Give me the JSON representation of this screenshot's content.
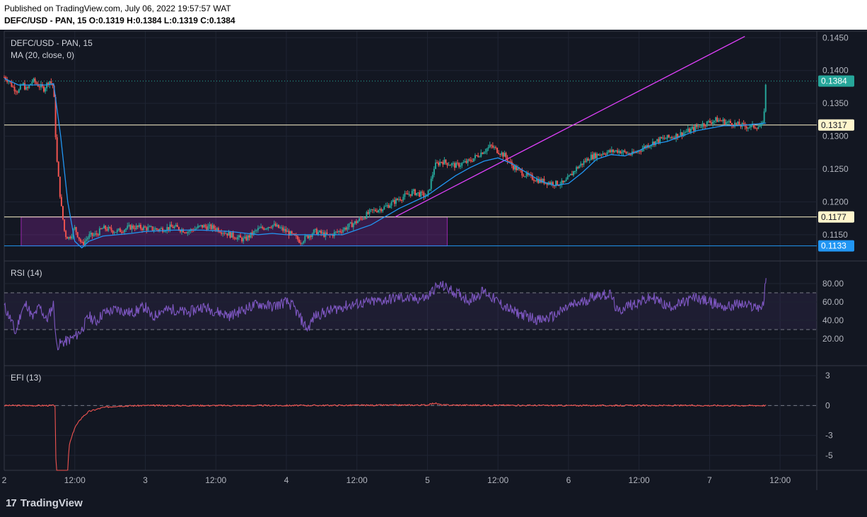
{
  "header": {
    "published": "Published on TradingView.com, July 06, 2022 19:57:57 WAT",
    "ohlc": "DEFC/USD - PAN, 15  O:0.1319 H:0.1384 L:0.1319 C:0.1384"
  },
  "branding": {
    "logo_text": "TradingView",
    "logo_icon": "tradingview-logo-icon"
  },
  "chart_data": [
    {
      "type": "candlestick",
      "title": "DEFC/USD - PAN, 15",
      "indicator": "MA (20, close, 0)",
      "ylim": [
        0.111,
        0.146
      ],
      "y_ticks": [
        "0.1450",
        "0.1400",
        "0.1350",
        "0.1300",
        "0.1250",
        "0.1200",
        "0.1150"
      ],
      "price_labels": [
        {
          "value": 0.1384,
          "text": "0.1384",
          "color": "#26a69a"
        },
        {
          "value": 0.1317,
          "text": "0.1317",
          "color": "#fff5cc"
        },
        {
          "value": 0.1177,
          "text": "0.1177",
          "color": "#fff5cc"
        },
        {
          "value": 0.1133,
          "text": "0.1133",
          "color": "#2196f3"
        }
      ],
      "horizontal_lines": [
        {
          "value": 0.1317,
          "color": "#fff5cc"
        },
        {
          "value": 0.1177,
          "color": "#fff5cc"
        },
        {
          "value": 0.1133,
          "color": "#2196f3"
        }
      ],
      "rectangle": {
        "x_start": 0.12,
        "x_end": 3.14,
        "y_low": 0.1133,
        "y_high": 0.1177,
        "color": "#9c27b0"
      },
      "trendline": {
        "x1": 2.77,
        "y1": 0.1177,
        "x2": 5.25,
        "y2": 0.1452,
        "color": "#e040fb"
      },
      "close_path": [
        [
          0.0,
          0.139
        ],
        [
          0.03,
          0.1385
        ],
        [
          0.06,
          0.1375
        ],
        [
          0.1,
          0.1368
        ],
        [
          0.13,
          0.138
        ],
        [
          0.16,
          0.137
        ],
        [
          0.2,
          0.1385
        ],
        [
          0.24,
          0.1378
        ],
        [
          0.28,
          0.1372
        ],
        [
          0.32,
          0.1385
        ],
        [
          0.35,
          0.1375
        ],
        [
          0.37,
          0.127
        ],
        [
          0.4,
          0.12
        ],
        [
          0.43,
          0.115
        ],
        [
          0.46,
          0.1145
        ],
        [
          0.5,
          0.116
        ],
        [
          0.55,
          0.1135
        ],
        [
          0.6,
          0.1148
        ],
        [
          0.65,
          0.115
        ],
        [
          0.7,
          0.116
        ],
        [
          0.8,
          0.1155
        ],
        [
          0.9,
          0.1162
        ],
        [
          1.0,
          0.116
        ],
        [
          1.1,
          0.1158
        ],
        [
          1.2,
          0.1162
        ],
        [
          1.3,
          0.1155
        ],
        [
          1.4,
          0.1163
        ],
        [
          1.5,
          0.116
        ],
        [
          1.6,
          0.115
        ],
        [
          1.7,
          0.1142
        ],
        [
          1.8,
          0.1158
        ],
        [
          1.9,
          0.1165
        ],
        [
          2.0,
          0.1155
        ],
        [
          2.1,
          0.114
        ],
        [
          2.2,
          0.1155
        ],
        [
          2.3,
          0.1148
        ],
        [
          2.4,
          0.1158
        ],
        [
          2.5,
          0.117
        ],
        [
          2.6,
          0.1185
        ],
        [
          2.7,
          0.1192
        ],
        [
          2.8,
          0.1205
        ],
        [
          2.9,
          0.1215
        ],
        [
          3.0,
          0.1208
        ],
        [
          3.05,
          0.1255
        ],
        [
          3.1,
          0.1262
        ],
        [
          3.2,
          0.1255
        ],
        [
          3.3,
          0.1262
        ],
        [
          3.4,
          0.1278
        ],
        [
          3.45,
          0.1285
        ],
        [
          3.55,
          0.127
        ],
        [
          3.6,
          0.1255
        ],
        [
          3.7,
          0.124
        ],
        [
          3.8,
          0.1232
        ],
        [
          3.9,
          0.1228
        ],
        [
          3.97,
          0.1228
        ],
        [
          4.05,
          0.125
        ],
        [
          4.15,
          0.1268
        ],
        [
          4.25,
          0.1275
        ],
        [
          4.35,
          0.1278
        ],
        [
          4.45,
          0.1272
        ],
        [
          4.55,
          0.1285
        ],
        [
          4.65,
          0.1295
        ],
        [
          4.75,
          0.13
        ],
        [
          4.85,
          0.1308
        ],
        [
          4.95,
          0.1318
        ],
        [
          5.05,
          0.1325
        ],
        [
          5.15,
          0.132
        ],
        [
          5.25,
          0.1315
        ],
        [
          5.35,
          0.1315
        ],
        [
          5.38,
          0.1317
        ],
        [
          5.4,
          0.1384
        ]
      ],
      "ma_path": [
        [
          0.0,
          0.1388
        ],
        [
          0.1,
          0.1378
        ],
        [
          0.2,
          0.1378
        ],
        [
          0.3,
          0.1378
        ],
        [
          0.35,
          0.138
        ],
        [
          0.4,
          0.13
        ],
        [
          0.45,
          0.12
        ],
        [
          0.5,
          0.114
        ],
        [
          0.55,
          0.113
        ],
        [
          0.6,
          0.114
        ],
        [
          0.7,
          0.1148
        ],
        [
          0.8,
          0.115
        ],
        [
          0.9,
          0.1152
        ],
        [
          1.0,
          0.1155
        ],
        [
          1.2,
          0.1157
        ],
        [
          1.4,
          0.1157
        ],
        [
          1.6,
          0.1155
        ],
        [
          1.8,
          0.115
        ],
        [
          1.9,
          0.1152
        ],
        [
          2.0,
          0.115
        ],
        [
          2.2,
          0.115
        ],
        [
          2.4,
          0.115
        ],
        [
          2.6,
          0.1165
        ],
        [
          2.8,
          0.119
        ],
        [
          3.0,
          0.121
        ],
        [
          3.1,
          0.1225
        ],
        [
          3.2,
          0.124
        ],
        [
          3.3,
          0.1252
        ],
        [
          3.4,
          0.1262
        ],
        [
          3.5,
          0.1267
        ],
        [
          3.6,
          0.1258
        ],
        [
          3.7,
          0.1245
        ],
        [
          3.8,
          0.1232
        ],
        [
          3.9,
          0.1225
        ],
        [
          4.0,
          0.1228
        ],
        [
          4.1,
          0.1245
        ],
        [
          4.2,
          0.1265
        ],
        [
          4.3,
          0.1272
        ],
        [
          4.4,
          0.127
        ],
        [
          4.5,
          0.1278
        ],
        [
          4.6,
          0.1288
        ],
        [
          4.7,
          0.1292
        ],
        [
          4.8,
          0.13
        ],
        [
          4.9,
          0.1308
        ],
        [
          5.0,
          0.1312
        ],
        [
          5.1,
          0.1316
        ],
        [
          5.2,
          0.1316
        ],
        [
          5.3,
          0.1318
        ],
        [
          5.4,
          0.132
        ]
      ]
    },
    {
      "type": "line",
      "title": "RSI (14)",
      "ylim": [
        0,
        100
      ],
      "y_ticks": [
        "80.00",
        "60.00",
        "40.00",
        "20.00"
      ],
      "levels": [
        70,
        30
      ],
      "series": [
        {
          "name": "RSI (14)",
          "points": [
            [
              0.0,
              55
            ],
            [
              0.05,
              40
            ],
            [
              0.08,
              25
            ],
            [
              0.12,
              50
            ],
            [
              0.16,
              58
            ],
            [
              0.2,
              42
            ],
            [
              0.25,
              55
            ],
            [
              0.3,
              40
            ],
            [
              0.35,
              58
            ],
            [
              0.37,
              12
            ],
            [
              0.4,
              15
            ],
            [
              0.45,
              18
            ],
            [
              0.5,
              22
            ],
            [
              0.55,
              30
            ],
            [
              0.6,
              45
            ],
            [
              0.65,
              38
            ],
            [
              0.7,
              48
            ],
            [
              0.8,
              52
            ],
            [
              0.9,
              48
            ],
            [
              1.0,
              55
            ],
            [
              1.05,
              42
            ],
            [
              1.1,
              50
            ],
            [
              1.2,
              52
            ],
            [
              1.3,
              48
            ],
            [
              1.4,
              55
            ],
            [
              1.5,
              50
            ],
            [
              1.6,
              45
            ],
            [
              1.7,
              52
            ],
            [
              1.8,
              58
            ],
            [
              1.9,
              55
            ],
            [
              2.0,
              60
            ],
            [
              2.05,
              55
            ],
            [
              2.1,
              42
            ],
            [
              2.15,
              30
            ],
            [
              2.2,
              45
            ],
            [
              2.3,
              50
            ],
            [
              2.4,
              55
            ],
            [
              2.5,
              58
            ],
            [
              2.6,
              60
            ],
            [
              2.7,
              62
            ],
            [
              2.8,
              65
            ],
            [
              2.9,
              63
            ],
            [
              3.0,
              65
            ],
            [
              3.05,
              75
            ],
            [
              3.1,
              78
            ],
            [
              3.2,
              70
            ],
            [
              3.3,
              62
            ],
            [
              3.4,
              72
            ],
            [
              3.5,
              60
            ],
            [
              3.6,
              50
            ],
            [
              3.7,
              45
            ],
            [
              3.8,
              40
            ],
            [
              3.9,
              45
            ],
            [
              4.0,
              55
            ],
            [
              4.1,
              60
            ],
            [
              4.2,
              68
            ],
            [
              4.3,
              68
            ],
            [
              4.35,
              48
            ],
            [
              4.4,
              55
            ],
            [
              4.5,
              60
            ],
            [
              4.6,
              65
            ],
            [
              4.7,
              55
            ],
            [
              4.8,
              58
            ],
            [
              4.9,
              65
            ],
            [
              5.0,
              60
            ],
            [
              5.1,
              55
            ],
            [
              5.15,
              55
            ],
            [
              5.2,
              58
            ],
            [
              5.3,
              55
            ],
            [
              5.38,
              55
            ],
            [
              5.4,
              86
            ]
          ]
        }
      ]
    },
    {
      "type": "line",
      "title": "EFI (13)",
      "ylim": [
        -6.5,
        4
      ],
      "y_ticks": [
        "3",
        "0",
        "-3",
        "-5"
      ],
      "levels": [
        0
      ],
      "series": [
        {
          "name": "EFI (13)",
          "points": [
            [
              0.0,
              0.0
            ],
            [
              0.3,
              0.0
            ],
            [
              0.36,
              0.0
            ],
            [
              0.37,
              -9.0
            ],
            [
              0.44,
              -9.0
            ],
            [
              0.46,
              -4.0
            ],
            [
              0.5,
              -2.2
            ],
            [
              0.55,
              -1.2
            ],
            [
              0.6,
              -0.6
            ],
            [
              0.7,
              -0.2
            ],
            [
              0.8,
              -0.05
            ],
            [
              1.0,
              0.0
            ],
            [
              2.0,
              0.0
            ],
            [
              3.0,
              0.05
            ],
            [
              3.05,
              0.25
            ],
            [
              3.1,
              0.05
            ],
            [
              4.0,
              0.0
            ],
            [
              5.0,
              0.0
            ],
            [
              5.4,
              0.0
            ]
          ]
        }
      ]
    }
  ],
  "x_axis": {
    "ticks": [
      {
        "pos": 0.0,
        "label": "2"
      },
      {
        "pos": 0.5,
        "label": "12:00"
      },
      {
        "pos": 1.0,
        "label": "3"
      },
      {
        "pos": 1.5,
        "label": "12:00"
      },
      {
        "pos": 2.0,
        "label": "4"
      },
      {
        "pos": 2.5,
        "label": "12:00"
      },
      {
        "pos": 3.0,
        "label": "5"
      },
      {
        "pos": 3.5,
        "label": "12:00"
      },
      {
        "pos": 4.0,
        "label": "6"
      },
      {
        "pos": 4.5,
        "label": "12:00"
      },
      {
        "pos": 5.0,
        "label": "7"
      },
      {
        "pos": 5.5,
        "label": "12:00"
      }
    ],
    "range": [
      0.0,
      5.76
    ]
  },
  "colors": {
    "background": "#131722",
    "grid": "#1f2433",
    "up": "#26a69a",
    "down": "#ef5350",
    "ma": "#2196f3",
    "rsi": "#7e57c2",
    "efi": "#ef5350"
  }
}
